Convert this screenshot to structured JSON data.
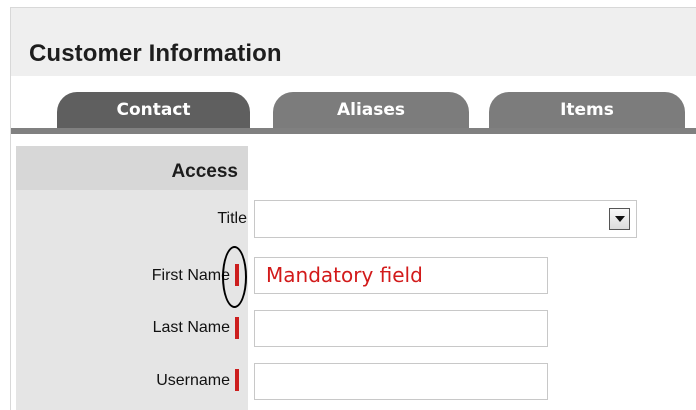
{
  "header": {
    "title": "Customer Information"
  },
  "tabs": [
    {
      "label": "Contact"
    },
    {
      "label": "Aliases"
    },
    {
      "label": "Items"
    }
  ],
  "section": {
    "label": "Access"
  },
  "fields": {
    "title": {
      "label": "Title",
      "value": ""
    },
    "first_name": {
      "label": "First Name",
      "value": "",
      "required": true
    },
    "last_name": {
      "label": "Last Name",
      "value": "",
      "required": true
    },
    "username": {
      "label": "Username",
      "value": "",
      "required": true
    }
  },
  "annotation": {
    "text": "Mandatory field",
    "color": "#d21a1a"
  },
  "colors": {
    "required_marker": "#cc1e1e",
    "active_tab": "#5f5f5f",
    "inactive_tab": "#7c7c7c",
    "tab_rule": "#808080",
    "label_column": "#e5e5e5"
  },
  "icons": {
    "select_toggle": "chevron-down-icon"
  }
}
